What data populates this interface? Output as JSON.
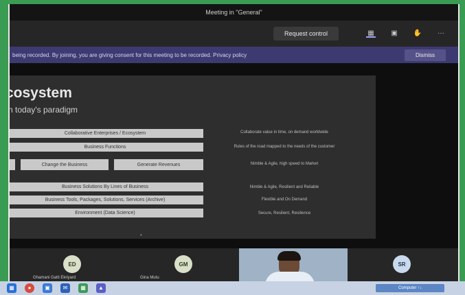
{
  "window": {
    "title": "Meeting in \"General\""
  },
  "toolbar": {
    "request_control_label": "Request control",
    "icons": [
      "camera-icon",
      "chat-icon",
      "hand-icon",
      "more-icon"
    ],
    "more_label": "···"
  },
  "notice": {
    "text": "being recorded. By joining, you are giving consent for this meeting to be recorded. Privacy policy",
    "dismiss_label": "Dismiss"
  },
  "slide": {
    "title": "cosystem",
    "subtitle": "n today's paradigm",
    "rows": [
      {
        "boxes": [
          "Collaborative Enterprises / Ecosystem"
        ],
        "desc": "Collaborate value in time, on demand worldwide"
      },
      {
        "boxes": [
          "Business Functions"
        ],
        "desc": "Rules of the road mapped to the needs of the customer"
      },
      {
        "boxes": [
          "",
          "Change the Business",
          "Generate Revenues"
        ],
        "desc": "Nimble & Agile, high speed to Market"
      },
      {
        "boxes": [
          "Business Solutions By Lines of Business"
        ],
        "desc": "Nimble & Agile, Resilient and Reliable"
      },
      {
        "boxes": [
          "Business Tools, Packages, Solutions, Services (Archive)"
        ],
        "desc": "Flexible and On Demand"
      },
      {
        "boxes": [
          "Environment (Data Science)"
        ],
        "desc": "Secure, Resilient, Resilience"
      }
    ]
  },
  "gallery": {
    "participants": [
      {
        "initials": "ED",
        "name": "Ghamani Gatti Ekriyard"
      },
      {
        "initials": "GM",
        "name": "Gina Mutu"
      },
      {
        "initials": "SR",
        "name": ""
      }
    ]
  },
  "taskbar": {
    "tray_text": "Computer ↑↓"
  }
}
